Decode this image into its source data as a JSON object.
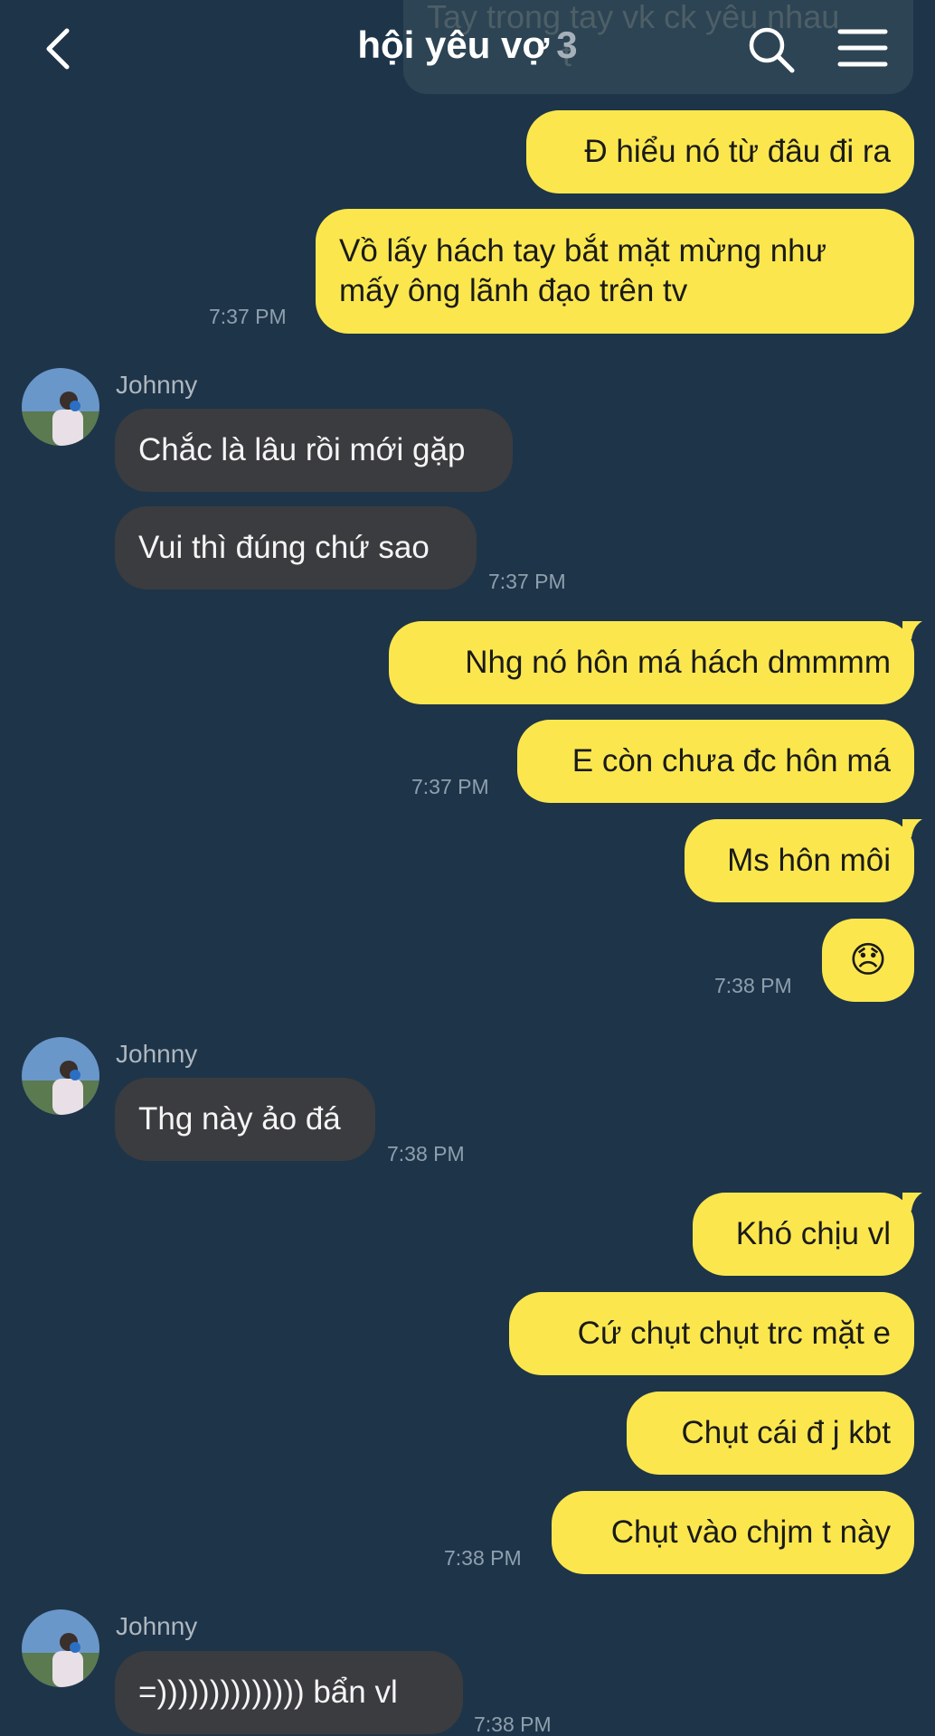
{
  "header": {
    "title": "hội yêu vợ",
    "member_count": "3",
    "back_icon": "chevron-left-icon",
    "search_icon": "search-icon",
    "menu_icon": "hamburger-menu-icon"
  },
  "pinned_preview": {
    "line1": "Tay trong tay vk ck yêu nhau",
    "line2": "t"
  },
  "colors": {
    "background": "#1e3449",
    "my_bubble": "#fbe74d",
    "their_bubble": "#3b3c3f",
    "timestamp": "#8ea0ad"
  },
  "messages": [
    {
      "from": "me",
      "text": "Đ hiểu nó từ đâu đi ra"
    },
    {
      "from": "me",
      "text": "Vồ lấy hách tay bắt mặt mừng như mấy ông lãnh đạo trên tv",
      "time": "7:37 PM"
    },
    {
      "from": "Johnny",
      "sender": "Johnny",
      "text": "Chắc là lâu rồi mới gặp"
    },
    {
      "from": "Johnny",
      "text": "Vui thì đúng chứ sao",
      "time": "7:37 PM"
    },
    {
      "from": "me",
      "text": "Nhg nó hôn má hách dmmmm"
    },
    {
      "from": "me",
      "text": "E còn chưa đc hôn má",
      "time": "7:37 PM"
    },
    {
      "from": "me",
      "text": "Ms hôn môi"
    },
    {
      "from": "me",
      "text": "😞",
      "time": "7:38 PM"
    },
    {
      "from": "Johnny",
      "sender": "Johnny",
      "text": "Thg này ảo đá",
      "time": "7:38 PM"
    },
    {
      "from": "me",
      "text": "Khó chịu vl"
    },
    {
      "from": "me",
      "text": "Cứ chụt chụt trc mặt e"
    },
    {
      "from": "me",
      "text": "Chụt cái đ j kbt"
    },
    {
      "from": "me",
      "text": "Chụt vào chjm t này",
      "time": "7:38 PM"
    },
    {
      "from": "Johnny",
      "sender": "Johnny",
      "text": "=)))))))))))))) bẩn vl",
      "time": "7:38 PM"
    }
  ]
}
